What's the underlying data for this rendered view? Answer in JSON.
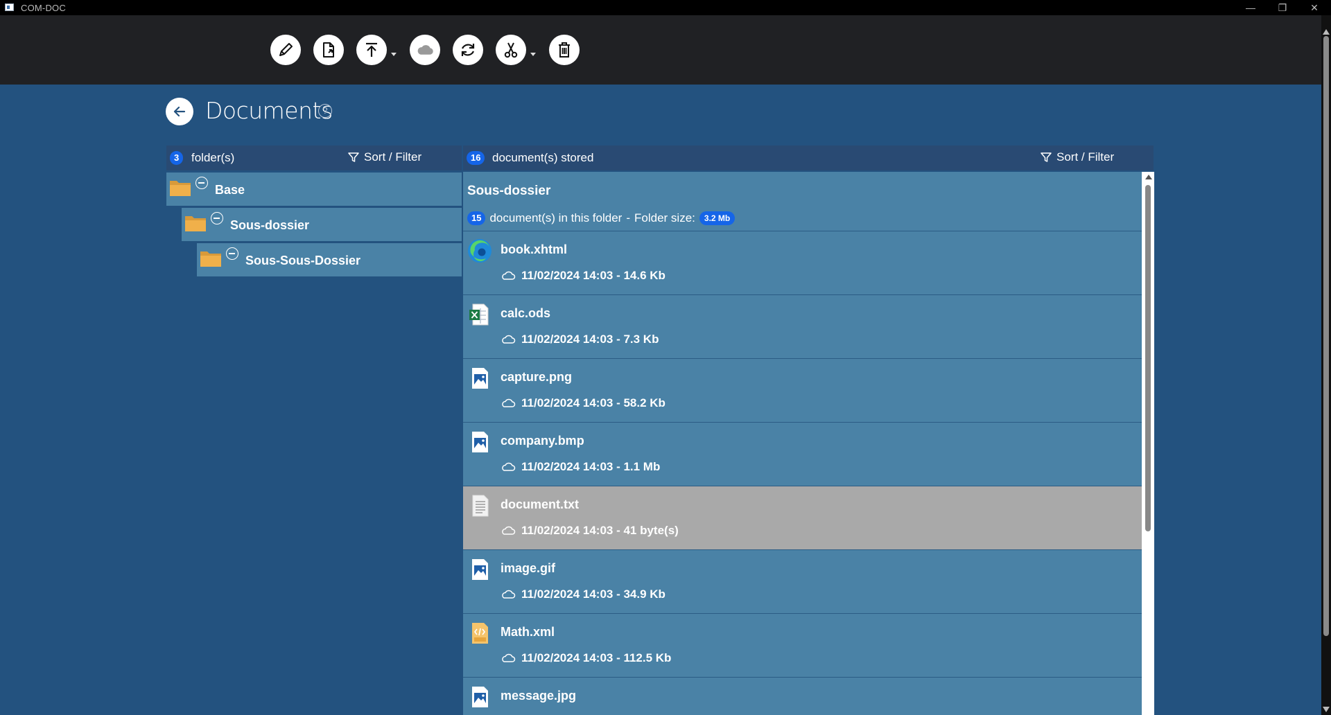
{
  "window": {
    "title": "COM-DOC",
    "minimize": "—",
    "restore": "❐",
    "close": "✕"
  },
  "toolbar": {
    "buttons": [
      {
        "name": "edit-button",
        "icon": "pencil-icon"
      },
      {
        "name": "export-document-button",
        "icon": "document-export-icon"
      },
      {
        "name": "upload-button",
        "icon": "upload-icon"
      },
      {
        "name": "cloud-button",
        "icon": "cloud-icon"
      },
      {
        "name": "refresh-button",
        "icon": "refresh-icon"
      },
      {
        "name": "cut-button",
        "icon": "scissors-icon"
      },
      {
        "name": "delete-button",
        "icon": "trash-icon"
      }
    ]
  },
  "header": {
    "title": "Documents",
    "help": "?"
  },
  "folders_panel": {
    "count": "3",
    "label": "folder(s)",
    "sort_filter": "Sort / Filter",
    "items": [
      {
        "name": "Base"
      },
      {
        "name": "Sous-dossier"
      },
      {
        "name": "Sous-Sous-Dossier"
      }
    ]
  },
  "docs_panel": {
    "count": "16",
    "label": "document(s) stored",
    "sort_filter": "Sort / Filter",
    "current_folder": {
      "title": "Sous-dossier",
      "doc_count": "15",
      "doc_label": "document(s) in this folder",
      "separator": "-",
      "size_label": "Folder size:",
      "size": "3.2 Mb"
    },
    "documents": [
      {
        "name": "book.xhtml",
        "meta": "11/02/2024 14:03 - 14.6 Kb",
        "icon": "edge-browser-icon",
        "selected": false
      },
      {
        "name": "calc.ods",
        "meta": "11/02/2024 14:03 - 7.3 Kb",
        "icon": "spreadsheet-icon",
        "selected": false
      },
      {
        "name": "capture.png",
        "meta": "11/02/2024 14:03 - 58.2 Kb",
        "icon": "image-file-icon",
        "selected": false
      },
      {
        "name": "company.bmp",
        "meta": "11/02/2024 14:03 - 1.1 Mb",
        "icon": "image-file-icon",
        "selected": false
      },
      {
        "name": "document.txt",
        "meta": "11/02/2024 14:03 - 41 byte(s)",
        "icon": "text-file-icon",
        "selected": true
      },
      {
        "name": "image.gif",
        "meta": "11/02/2024 14:03 - 34.9 Kb",
        "icon": "image-file-icon",
        "selected": false
      },
      {
        "name": "Math.xml",
        "meta": "11/02/2024 14:03 - 112.5 Kb",
        "icon": "xml-file-icon",
        "selected": false
      },
      {
        "name": "message.jpg",
        "meta": "",
        "icon": "image-file-icon",
        "selected": false
      }
    ]
  },
  "colors": {
    "background": "#23527f",
    "toolbar": "#202124",
    "panel_header": "#294a73",
    "row": "#4a82a6",
    "selected_row": "#a9a9a9",
    "badge": "#1565e8",
    "folder": "#f0b04a"
  }
}
